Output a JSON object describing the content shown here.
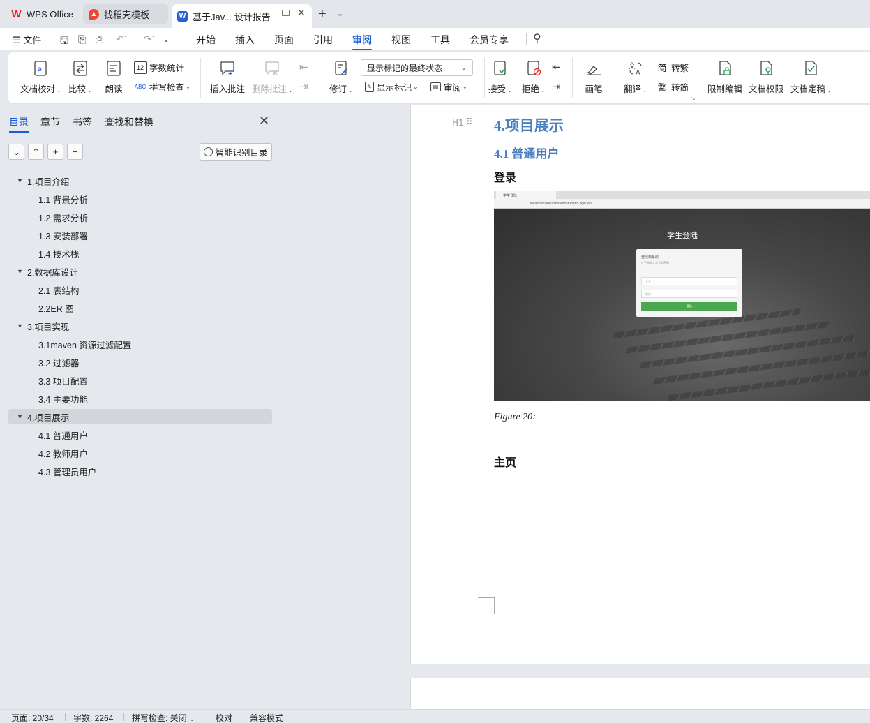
{
  "tabs": [
    {
      "label": "WPS Office",
      "icon": "wps-logo-icon"
    },
    {
      "label": "找稻壳模板",
      "icon": "docer-icon"
    },
    {
      "label": "基于Jav... 设计报告",
      "icon": "word-doc-icon"
    }
  ],
  "menu": {
    "file": "文件",
    "items": [
      "开始",
      "插入",
      "页面",
      "引用",
      "审阅",
      "视图",
      "工具",
      "会员专享"
    ],
    "active": "审阅"
  },
  "ribbon": {
    "proofread": "文档校对",
    "compare": "比较",
    "read_aloud": "朗读",
    "word_count": "字数统计",
    "spell_check": "拼写检查",
    "insert_comment": "插入批注",
    "delete_comment": "删除批注",
    "track_changes": "修订",
    "markup_state": "显示标记的最终状态",
    "show_markup": "显示标记",
    "review_pane": "审阅",
    "accept": "接受",
    "reject": "拒绝",
    "ink": "画笔",
    "translate": "翻译",
    "to_traditional": "转繁",
    "to_simplified": "转简",
    "restrict_edit": "限制编辑",
    "doc_permission": "文档权限",
    "doc_finalize": "文档定稿"
  },
  "sidebar": {
    "tabs": [
      "目录",
      "章节",
      "书签",
      "查找和替换"
    ],
    "active_tab": "目录",
    "smart_toc": "智能识别目录",
    "toc": [
      {
        "label": "1.项目介绍",
        "level": 1
      },
      {
        "label": "1.1 背景分析",
        "level": 2
      },
      {
        "label": "1.2 需求分析",
        "level": 2
      },
      {
        "label": "1.3 安装部署",
        "level": 2
      },
      {
        "label": "1.4 技术栈",
        "level": 2
      },
      {
        "label": "2.数据库设计",
        "level": 1
      },
      {
        "label": "2.1 表结构",
        "level": 2
      },
      {
        "label": "2.2ER 图",
        "level": 2
      },
      {
        "label": "3.项目实现",
        "level": 1
      },
      {
        "label": "3.1maven 资源过滤配置",
        "level": 2
      },
      {
        "label": "3.2 过滤器",
        "level": 2
      },
      {
        "label": "3.3 项目配置",
        "level": 2
      },
      {
        "label": "3.4 主要功能",
        "level": 2
      },
      {
        "label": "4.项目展示",
        "level": 1,
        "selected": true
      },
      {
        "label": "4.1 普通用户",
        "level": 2
      },
      {
        "label": "4.2 教师用户",
        "level": 2
      },
      {
        "label": "4.3 管理员用户",
        "level": 2
      }
    ]
  },
  "document": {
    "h1_marker": "H1",
    "heading1": "4.项目展示",
    "heading2": "4.1 普通用户",
    "heading_login": "登录",
    "caption": "Figure 20:",
    "heading_home": "主页",
    "screenshot": {
      "url": "localhost:8080/student/studentLogin.jsp",
      "tab_label": "学生登陆",
      "title": "学生登陆",
      "card_title": "登陆到系统",
      "card_sub": "在下面输入学号和密码",
      "field1": "学号",
      "field2": "密码",
      "button": "登陆"
    }
  },
  "status": {
    "page": "页面: 20/34",
    "words": "字数: 2264",
    "spell": "拼写检查: 关闭",
    "proof": "校对",
    "compat": "兼容模式"
  }
}
